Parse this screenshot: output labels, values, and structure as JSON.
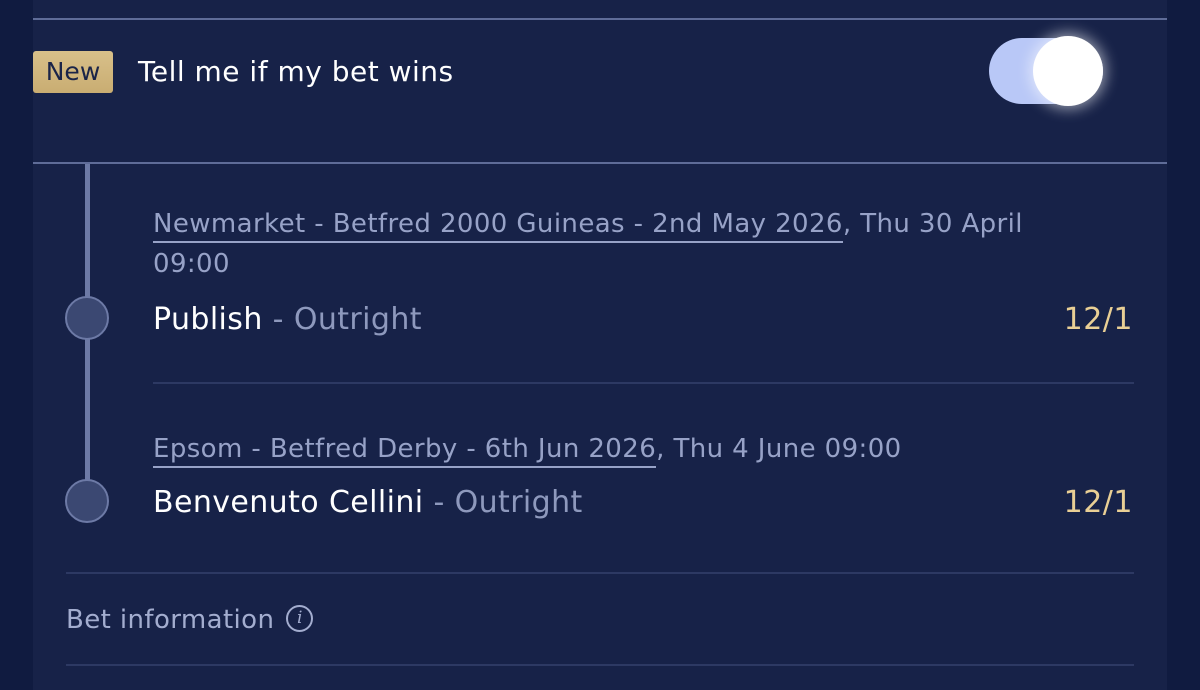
{
  "notify": {
    "badge": "New",
    "label": "Tell me if my bet wins",
    "toggle_on": true
  },
  "legs": [
    {
      "event_link": "Newmarket - Betfred 2000 Guineas - 2nd May 2026",
      "event_datetime_line1": ", Thu 30 April",
      "event_datetime_line2": "09:00",
      "selection": "Publish",
      "market": " - Outright",
      "odds": "12/1"
    },
    {
      "event_link": "Epsom - Betfred Derby - 6th Jun 2026",
      "event_datetime_line1": ", Thu 4 June 09:00",
      "selection": "Benvenuto Cellini",
      "market": " - Outright",
      "odds": "12/1"
    }
  ],
  "bet_info": {
    "label": "Bet information",
    "icon": "info-icon"
  },
  "colors": {
    "background": "#101b40",
    "card": "#172248",
    "accent_gold": "#e9cf95",
    "toggle_track": "#b9c8f7"
  }
}
